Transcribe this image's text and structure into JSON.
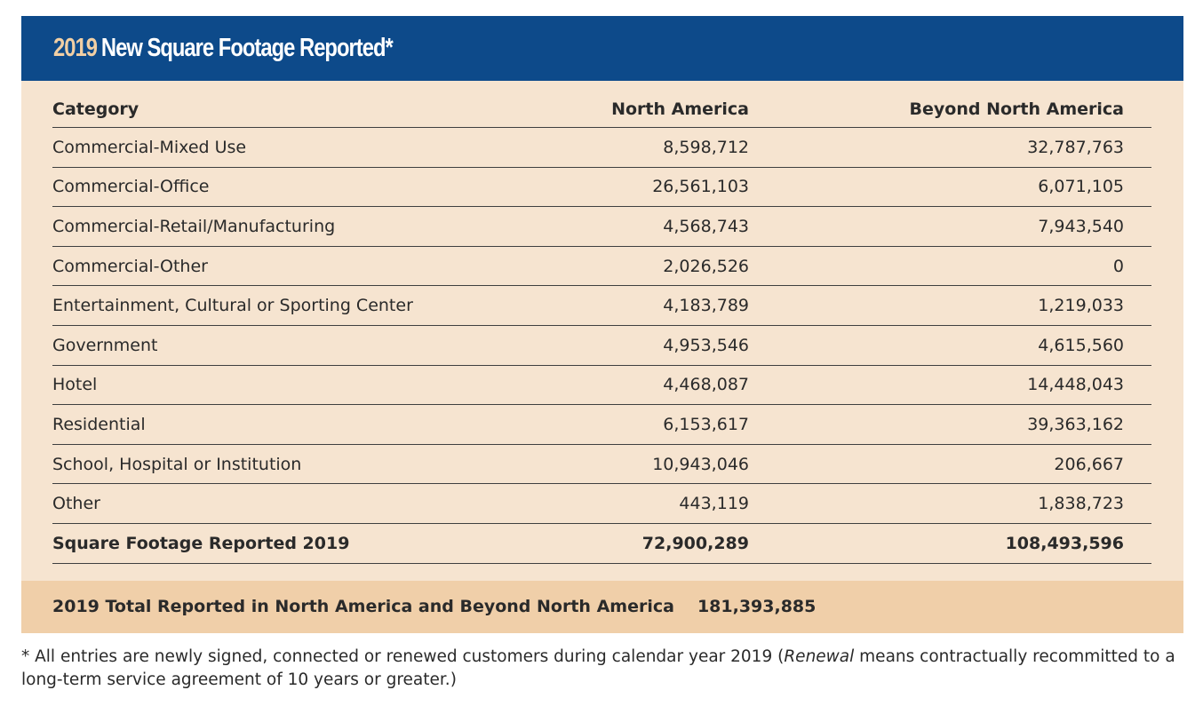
{
  "header": {
    "year": "2019",
    "title": "New Square Footage Reported*"
  },
  "table": {
    "columns": [
      "Category",
      "North America",
      "Beyond North America"
    ],
    "rows": [
      {
        "category": "Commercial-Mixed Use",
        "north_america": "8,598,712",
        "beyond_north_america": "32,787,763"
      },
      {
        "category": "Commercial-Office",
        "north_america": "26,561,103",
        "beyond_north_america": "6,071,105"
      },
      {
        "category": "Commercial-Retail/Manufacturing",
        "north_america": "4,568,743",
        "beyond_north_america": "7,943,540"
      },
      {
        "category": "Commercial-Other",
        "north_america": "2,026,526",
        "beyond_north_america": "0"
      },
      {
        "category": "Entertainment, Cultural or Sporting Center",
        "north_america": "4,183,789",
        "beyond_north_america": "1,219,033"
      },
      {
        "category": "Government",
        "north_america": "4,953,546",
        "beyond_north_america": "4,615,560"
      },
      {
        "category": "Hotel",
        "north_america": "4,468,087",
        "beyond_north_america": "14,448,043"
      },
      {
        "category": "Residential",
        "north_america": "6,153,617",
        "beyond_north_america": "39,363,162"
      },
      {
        "category": "School, Hospital or Institution",
        "north_america": "10,943,046",
        "beyond_north_america": "206,667"
      },
      {
        "category": "Other",
        "north_america": "443,119",
        "beyond_north_america": "1,838,723"
      }
    ],
    "total": {
      "label": "Square Footage Reported 2019",
      "north_america": "72,900,289",
      "beyond_north_america": "108,493,596"
    }
  },
  "grand_total": {
    "label": "2019 Total Reported in North America and Beyond North America",
    "value": "181,393,885"
  },
  "footnote": {
    "prefix": "* All entries are newly signed, connected or renewed customers during calendar year 2019 (",
    "emphasis": "Renewal",
    "suffix": " means contractually recommitted to a long-term service agreement of 10 years or greater.)"
  },
  "colors": {
    "header_bg": "#0d4a8a",
    "header_year": "#f1cfa4",
    "body_bg": "#f6e4d0",
    "grand_total_bg": "#f0cfa9"
  }
}
